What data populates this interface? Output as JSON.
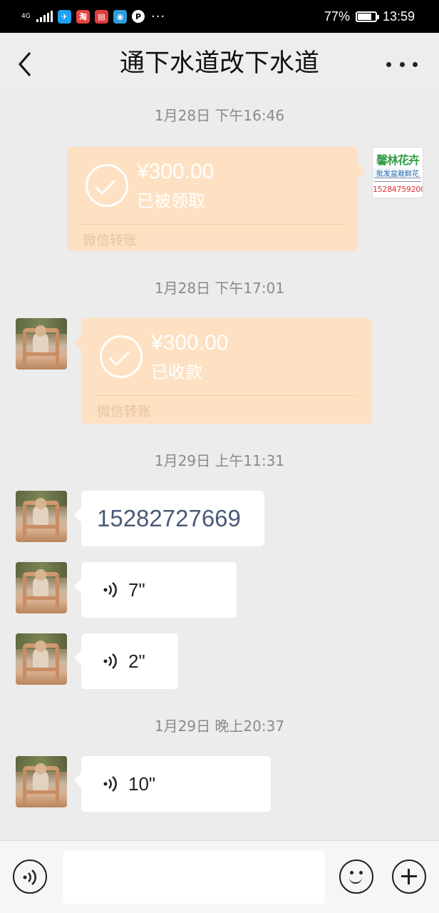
{
  "status_bar": {
    "network": "4G",
    "battery": "77%",
    "battery_level": 0.77,
    "time": "13:59",
    "app_icons": [
      "twitter-bird-icon",
      "taobao-icon",
      "red-book-icon",
      "weibo-icon",
      "p-icon"
    ],
    "overflow": "···"
  },
  "header": {
    "title": "通下水道改下水道"
  },
  "messages": [
    {
      "timestamp": "1月28日 下午16:46",
      "type": "transfer",
      "side": "right",
      "amount": "¥300.00",
      "state": "已被领取",
      "footer": "微信转账"
    },
    {
      "timestamp": "1月28日 下午17:01",
      "type": "transfer",
      "side": "left",
      "amount": "¥300.00",
      "state": "已收款",
      "footer": "微信转账"
    },
    {
      "timestamp": "1月29日 上午11:31",
      "type": "text",
      "side": "left",
      "text": "15282727669"
    },
    {
      "type": "voice",
      "side": "left",
      "duration": "7\""
    },
    {
      "type": "voice",
      "side": "left",
      "duration": "2\""
    },
    {
      "timestamp": "1月29日 晚上20:37",
      "type": "voice",
      "side": "left",
      "duration": "10\""
    }
  ],
  "self_avatar": {
    "name": "馨林花卉",
    "tagline": "批发盆栽鲜花",
    "phone": "15284759200"
  },
  "input_bar": {
    "placeholder": ""
  },
  "colors": {
    "transfer_bg": "#fde1c2",
    "background": "#ececec",
    "link_text": "#4a5a78"
  }
}
